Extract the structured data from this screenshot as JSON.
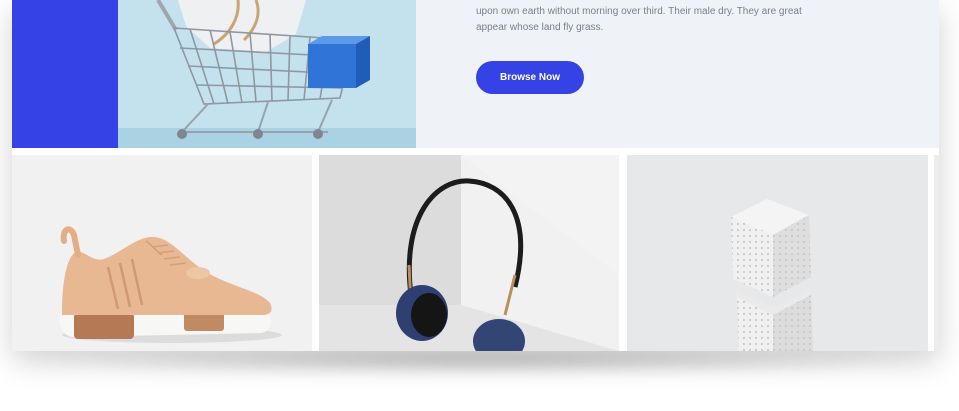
{
  "hero": {
    "description": "upon own earth without morning over third. Their male dry. They are great appear whose land fly grass.",
    "button_label": "Browse Now",
    "accent_color": "#3442e6",
    "background_color": "#eff3f8"
  },
  "products": [
    {
      "icon": "sneaker-image"
    },
    {
      "icon": "headphones-image"
    },
    {
      "icon": "speaker-cube-image"
    }
  ]
}
